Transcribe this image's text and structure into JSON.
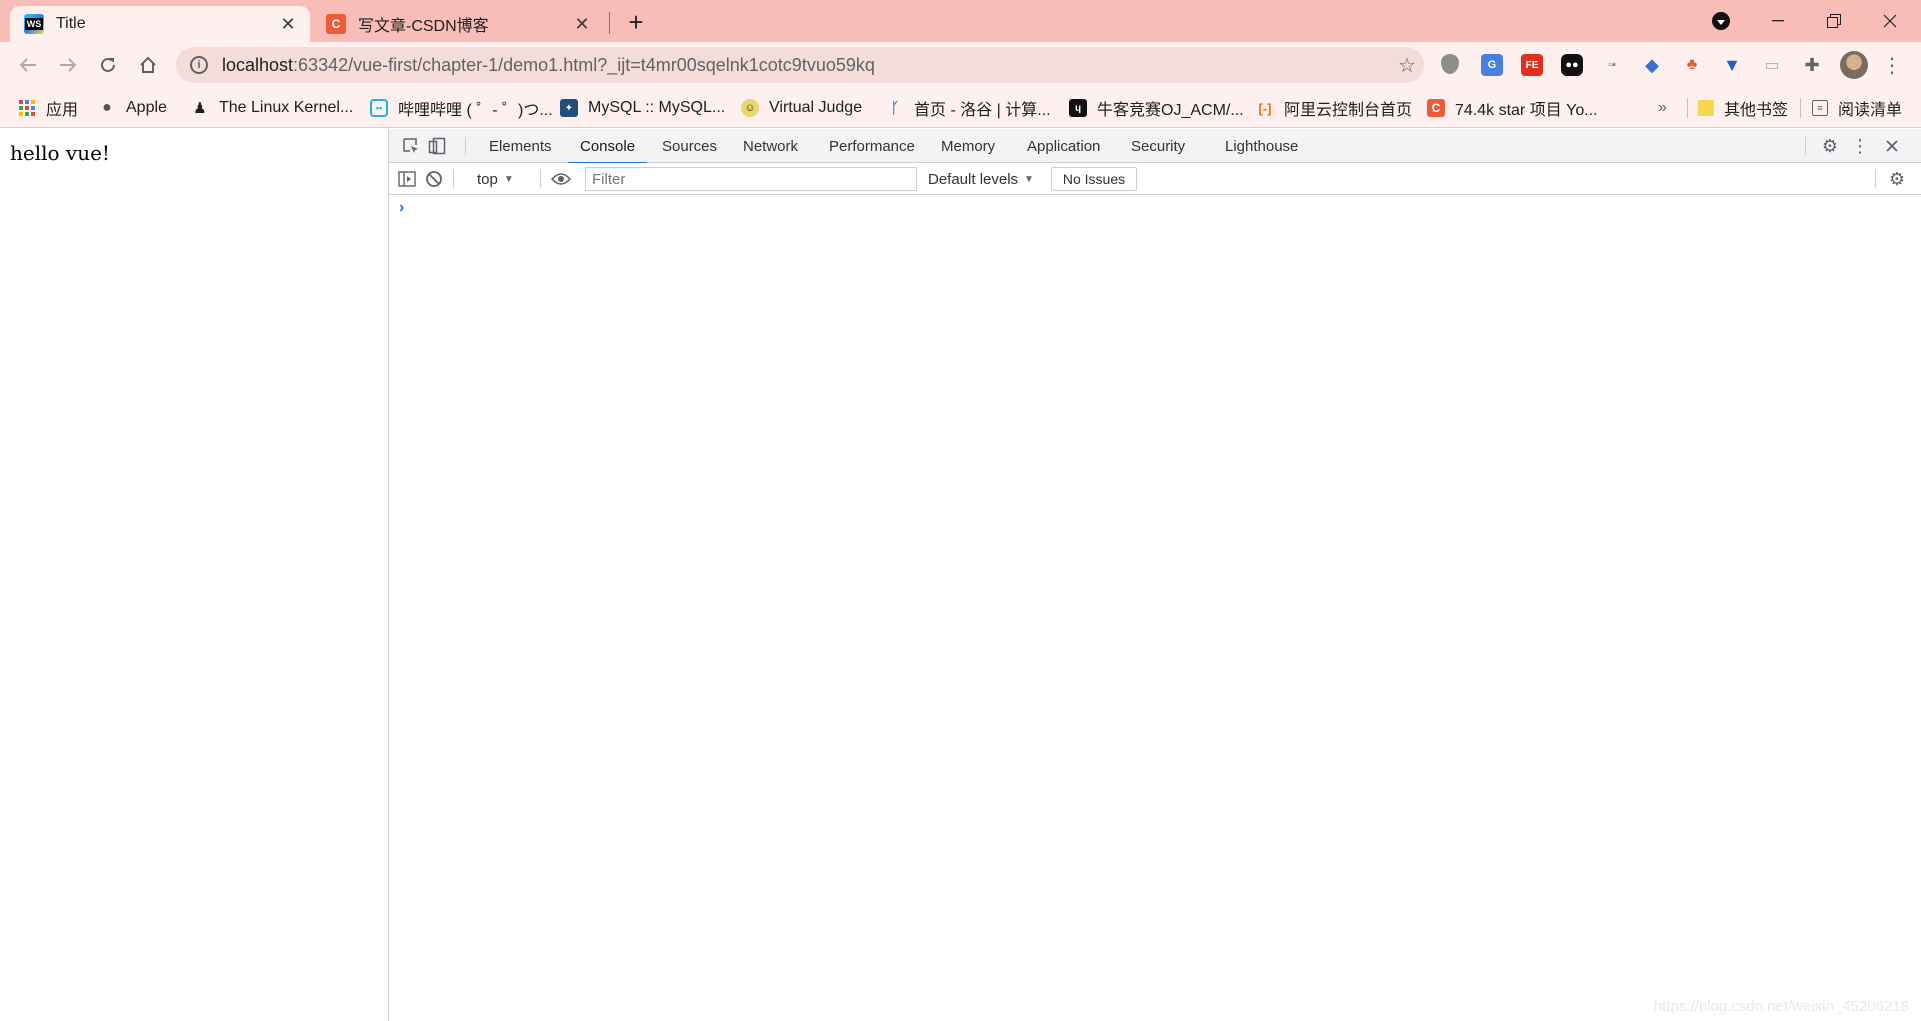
{
  "tabs": [
    {
      "title": "Title",
      "favicon": "webstorm-icon",
      "active": true
    },
    {
      "title": "写文章-CSDN博客",
      "favicon": "csdn-icon",
      "active": false
    }
  ],
  "address_bar": {
    "host": "localhost",
    "path": ":63342/vue-first/chapter-1/demo1.html?_ijt=t4mr00sqelnk1cotc9tvuo59kq"
  },
  "bookmarks": [
    {
      "label": "应用",
      "icon": "apps-grid-icon"
    },
    {
      "label": "Apple",
      "icon": "apple-icon"
    },
    {
      "label": "The Linux Kernel...",
      "icon": "tux-icon"
    },
    {
      "label": "哔哩哔哩 ( ゜- ゜)つ...",
      "icon": "bilibili-icon"
    },
    {
      "label": "MySQL :: MySQL...",
      "icon": "mysql-icon"
    },
    {
      "label": "Virtual Judge",
      "icon": "vjudge-icon"
    },
    {
      "label": "首页 - 洛谷 | 计算...",
      "icon": "luogu-icon"
    },
    {
      "label": "牛客竞赛OJ_ACM/...",
      "icon": "nowcoder-icon"
    },
    {
      "label": "阿里云控制台首页",
      "icon": "aliyun-icon"
    },
    {
      "label": "74.4k star 项目 Yo...",
      "icon": "csdn-icon"
    }
  ],
  "bookmarks_overflow": "»",
  "other_bookmarks": "其他书签",
  "reading_list": "阅读清单",
  "page": {
    "text": "hello vue!"
  },
  "devtools": {
    "tabs": [
      "Elements",
      "Console",
      "Sources",
      "Network",
      "Performance",
      "Memory",
      "Application",
      "Security",
      "Lighthouse"
    ],
    "active_tab": "Console",
    "context": "top",
    "filter_placeholder": "Filter",
    "levels": "Default levels",
    "issues": "No Issues",
    "prompt": "›"
  },
  "watermark": "https://blog.csdn.net/weixin_45206218",
  "colors": {
    "tab_strip": "#f8bdb6",
    "toolbar": "#fdf0ee",
    "accent": "#1a73e8"
  }
}
